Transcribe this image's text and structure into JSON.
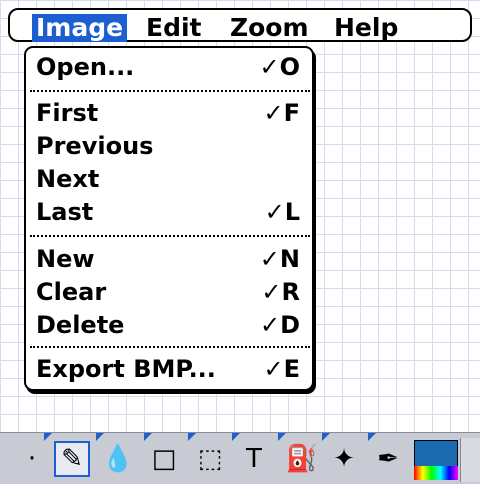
{
  "menubar": {
    "items": [
      "Image",
      "Edit",
      "Zoom",
      "Help"
    ],
    "active": "Image"
  },
  "menu": {
    "groups": [
      [
        {
          "label": "Open...",
          "shortcut": "✓O"
        }
      ],
      [
        {
          "label": "First",
          "shortcut": "✓F"
        },
        {
          "label": "Previous",
          "shortcut": ""
        },
        {
          "label": "Next",
          "shortcut": ""
        },
        {
          "label": "Last",
          "shortcut": "✓L"
        }
      ],
      [
        {
          "label": "New",
          "shortcut": "✓N"
        },
        {
          "label": "Clear",
          "shortcut": "✓R"
        },
        {
          "label": "Delete",
          "shortcut": "✓D"
        }
      ],
      [
        {
          "label": "Export BMP...",
          "shortcut": "✓E"
        }
      ]
    ]
  },
  "toolbar": {
    "tools": [
      {
        "icon": "dot-icon",
        "glyph": "·"
      },
      {
        "icon": "pencil-icon",
        "glyph": "✎"
      },
      {
        "icon": "drop-icon",
        "glyph": "💧"
      },
      {
        "icon": "rectangle-icon",
        "glyph": "□"
      },
      {
        "icon": "selection-icon",
        "glyph": "⬚"
      },
      {
        "icon": "text-icon",
        "glyph": "T"
      },
      {
        "icon": "paint-bucket-icon",
        "glyph": "⛽"
      },
      {
        "icon": "spray-icon",
        "glyph": "✦"
      },
      {
        "icon": "eyedropper-icon",
        "glyph": "✒"
      }
    ],
    "selected_index": 1,
    "color_swatch": "#1a6bb0"
  }
}
